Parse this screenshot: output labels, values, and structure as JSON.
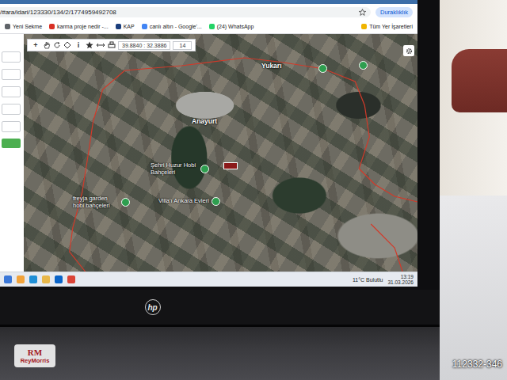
{
  "browser": {
    "url": "/#ara/idari/123330/134/2/1774959492708",
    "profile": "Duraklıklık",
    "bookmarks": [
      {
        "label": "Yeni Sekme",
        "color": "#5f6368"
      },
      {
        "label": "karma proje nedir -...",
        "color": "#d93025"
      },
      {
        "label": "KAP",
        "color": "#1a3d7c"
      },
      {
        "label": "canlı altın - Google'...",
        "color": "#4285f4"
      },
      {
        "label": "(24) WhatsApp",
        "color": "#25d366"
      }
    ],
    "all_bookmarks": "Tüm Yer İşaretleri"
  },
  "map": {
    "toolbar": {
      "zoom_in": "+",
      "info": "i",
      "coordinates": "39.8840 : 32.3886",
      "zoom": "14"
    },
    "places": [
      {
        "label": "Anayurt",
        "kind": "town"
      },
      {
        "label": "Şehri Huzur Hobi Bahçeleri",
        "kind": "poi"
      },
      {
        "label": "Villa'ı Ankara Evleri",
        "kind": "poi"
      },
      {
        "label": "freyja garden hobi bahçeleri",
        "kind": "poi"
      },
      {
        "label": "Yukarı",
        "kind": "town"
      }
    ]
  },
  "taskbar": {
    "weather": "11°C Bulutlu",
    "time": "13:19",
    "date": "31.03.2026"
  },
  "laptop": {
    "brand": "hp"
  },
  "watermark": {
    "logo": "RM",
    "name": "ReyMorris",
    "listing_id": "112332-346"
  }
}
